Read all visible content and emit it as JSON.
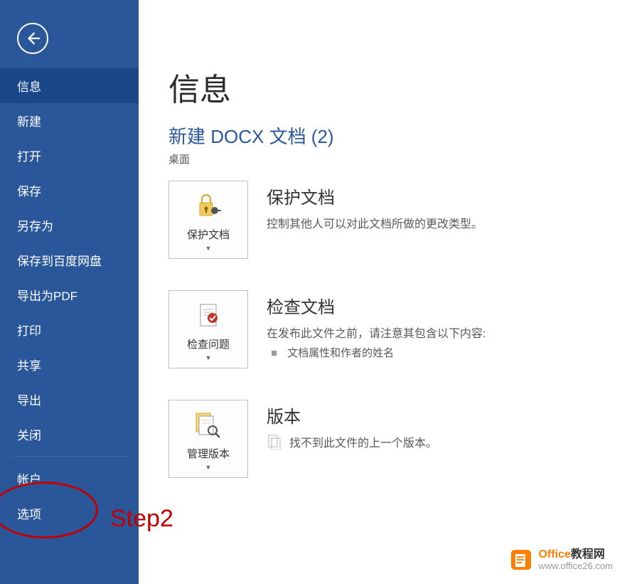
{
  "sidebar": {
    "items": [
      {
        "label": "信息",
        "selected": true
      },
      {
        "label": "新建",
        "selected": false
      },
      {
        "label": "打开",
        "selected": false
      },
      {
        "label": "保存",
        "selected": false
      },
      {
        "label": "另存为",
        "selected": false
      },
      {
        "label": "保存到百度网盘",
        "selected": false
      },
      {
        "label": "导出为PDF",
        "selected": false
      },
      {
        "label": "打印",
        "selected": false
      },
      {
        "label": "共享",
        "selected": false
      },
      {
        "label": "导出",
        "selected": false
      },
      {
        "label": "关闭",
        "selected": false
      }
    ],
    "footer_items": [
      {
        "label": "帐户"
      },
      {
        "label": "选项"
      }
    ]
  },
  "main": {
    "page_title": "信息",
    "doc_title": "新建 DOCX 文档 (2)",
    "doc_location": "桌面",
    "protect": {
      "button_label": "保护文档",
      "title": "保护文档",
      "desc": "控制其他人可以对此文档所做的更改类型。"
    },
    "inspect": {
      "button_label": "检查问题",
      "title": "检查文档",
      "desc": "在发布此文件之前，请注意其包含以下内容:",
      "list_item": "文档属性和作者的姓名"
    },
    "versions": {
      "button_label": "管理版本",
      "title": "版本",
      "desc": "找不到此文件的上一个版本。"
    }
  },
  "annotation": {
    "label": "Step2"
  },
  "watermark": {
    "brand_orange": "Office",
    "brand_black": "教程网",
    "url": "www.office26.com"
  }
}
